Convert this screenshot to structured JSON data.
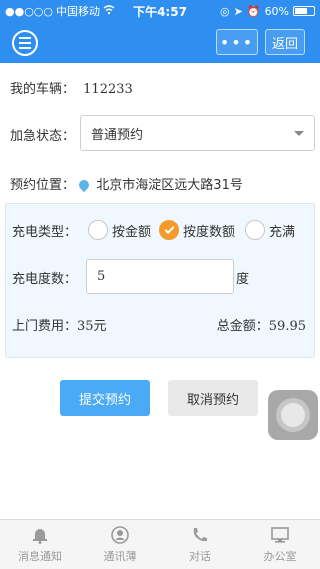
{
  "status_bar": {
    "carrier": "中国移动",
    "time": "下午4:57",
    "battery": "60%"
  },
  "nav": {
    "more_label": "•••",
    "back_label": "返回"
  },
  "vehicle": {
    "label": "我的车辆：",
    "value": "112233"
  },
  "urgent_status": {
    "label": "加急状态：",
    "selected": "普通预约"
  },
  "location": {
    "label": "预约位置：",
    "value": "北京市海淀区远大路31号"
  },
  "charge_type": {
    "label": "充电类型：",
    "options": [
      {
        "label": "按金额",
        "checked": false
      },
      {
        "label": "按度数额",
        "checked": true
      },
      {
        "label": "充满",
        "checked": false
      }
    ]
  },
  "charge_degree": {
    "label": "充电度数：",
    "value": "5",
    "unit": "度"
  },
  "fees": {
    "visit_label": "上门费用：",
    "visit_value": "35元",
    "total_label": "总金额：",
    "total_value": "59.95"
  },
  "actions": {
    "submit_label": "提交预约",
    "cancel_label": "取消预约"
  },
  "tabs": [
    {
      "label": "消息通知",
      "icon": "bell-icon"
    },
    {
      "label": "通讯薄",
      "icon": "contact-icon"
    },
    {
      "label": "对话",
      "icon": "phone-icon"
    },
    {
      "label": "办公室",
      "icon": "monitor-icon"
    }
  ],
  "colors": {
    "primary": "#2f8ff0",
    "accent_orange": "#f39a2b",
    "submit_blue": "#4aaaf5"
  }
}
